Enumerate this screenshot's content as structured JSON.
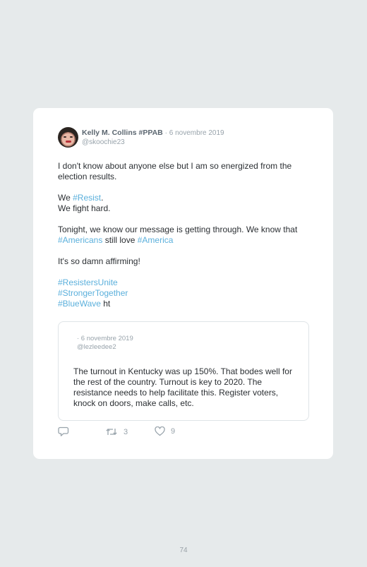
{
  "tweet": {
    "display_name": "Kelly M. Collins #PPAB",
    "date": "· 6 novembre 2019",
    "handle": "@skoochie23",
    "paragraph1": "I don't know about anyone else but I am so energized from the election results.",
    "p2_we": "We ",
    "p2_resist": "#Resist",
    "p2_dot": ".",
    "p2_line2": "We fight hard.",
    "p3_text1": "Tonight, we know our message is getting through. We know that ",
    "p3_americans": "#Americans",
    "p3_text2": " still love ",
    "p3_america": "#America",
    "p4": "It's so damn affirming!",
    "tag1": "#ResistersUnite",
    "tag2": "#StrongerTogether",
    "tag3": "#BlueWave",
    "tag3_suffix": " ht"
  },
  "quote": {
    "date": "· 6 novembre 2019",
    "handle": "@lezleedee2",
    "text": "The turnout in Kentucky was up 150%. That bodes well for the rest of the country. Turnout is key to 2020. The resistance needs to help facilitate this. Register voters, knock on doors, make calls, etc."
  },
  "actions": {
    "reply_icon": "reply-icon",
    "retweet_icon": "retweet-icon",
    "retweet_count": "3",
    "like_icon": "heart-icon",
    "like_count": "9"
  },
  "page_number": "74",
  "colors": {
    "background": "#e6eaeb",
    "card": "#ffffff",
    "hashtag": "#5bb0dc",
    "muted": "#98a3ab",
    "name": "#5b6670"
  }
}
